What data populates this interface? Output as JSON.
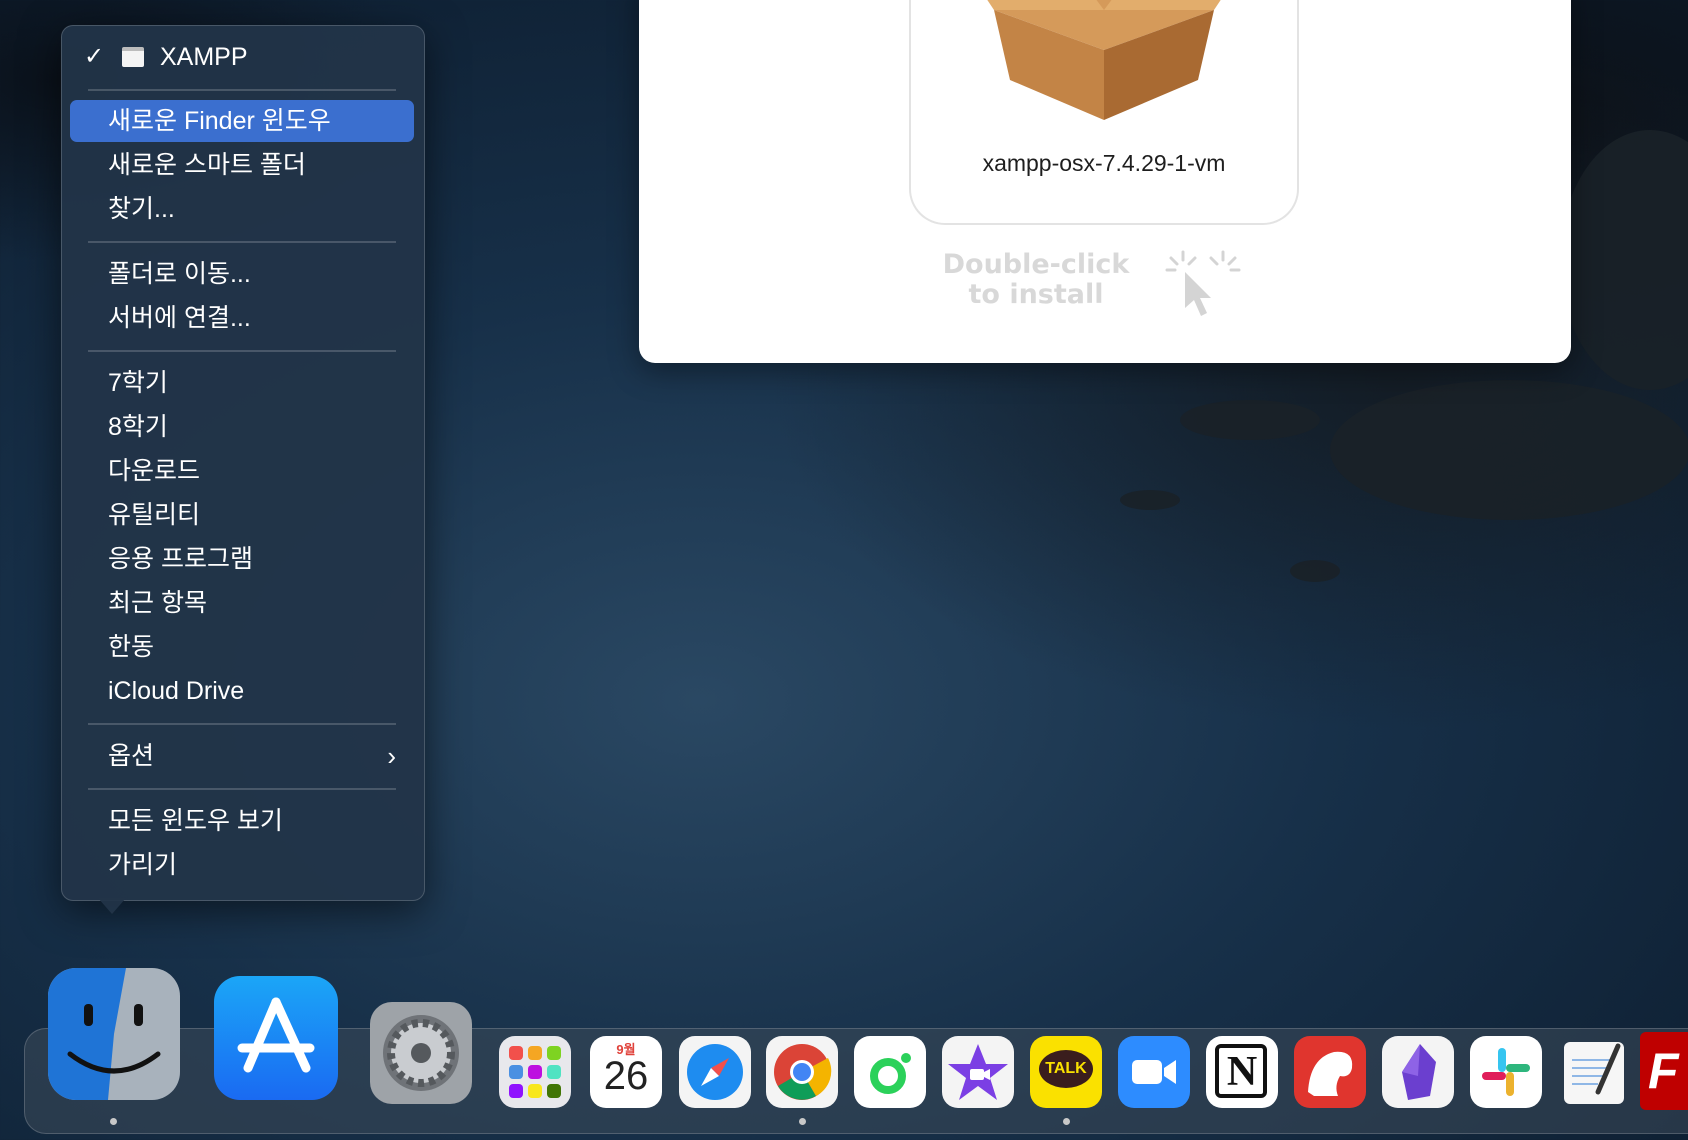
{
  "context_menu": {
    "window_item": {
      "check": "✓",
      "label": "XAMPP"
    },
    "group1": [
      "새로운 Finder 윈도우",
      "새로운 스마트 폴더",
      "찾기..."
    ],
    "group2": [
      "폴더로 이동...",
      "서버에 연결..."
    ],
    "places": [
      "7학기",
      "8학기",
      "다운로드",
      "유틸리티",
      "응용 프로그램",
      "최근 항목",
      "한동",
      "iCloud Drive"
    ],
    "options": "옵션",
    "group4": [
      "모든 윈도우 보기",
      "가리기"
    ],
    "selected_item": "새로운 Finder 윈도우"
  },
  "installer": {
    "package_name": "xampp-osx-7.4.29-1-vm",
    "hint_line1": "Double-click",
    "hint_line2": "to install"
  },
  "dock": {
    "calendar_month": "9월",
    "calendar_day": "26",
    "kakaotalk_label": "TALK",
    "notion_letter": "N",
    "filezilla_letter": "F"
  }
}
